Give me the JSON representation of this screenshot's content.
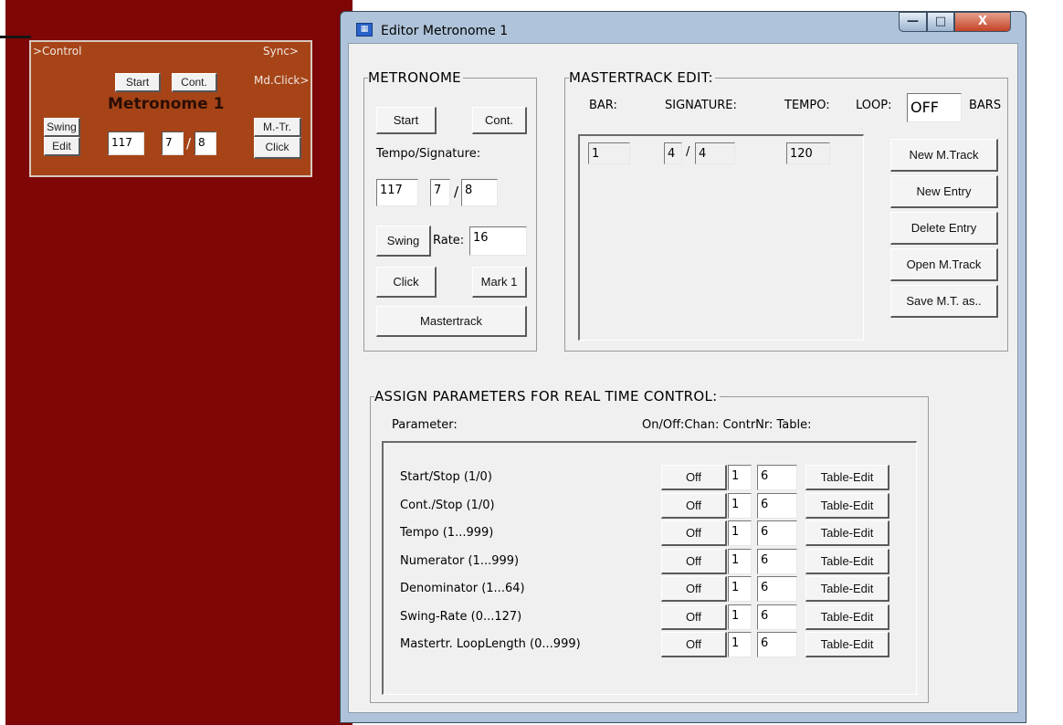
{
  "module": {
    "in_label": ">Control",
    "sync_label": "Sync>",
    "mdclick_label": "Md.Click>",
    "title": "Metronome 1",
    "start": "Start",
    "cont": "Cont.",
    "swing": "Swing",
    "edit": "Edit",
    "mtr": "M.-Tr.",
    "click": "Click",
    "tempo": "117",
    "numerator": "7",
    "slash": "/",
    "denominator": "8"
  },
  "window": {
    "title": "Editor Metronome 1",
    "icon": "app-icon",
    "minimize": "—",
    "maximize": "□",
    "close": "X"
  },
  "metronome": {
    "title": "METRONOME",
    "start": "Start",
    "cont": "Cont.",
    "tempo_sig_label": "Tempo/Signature:",
    "tempo": "117",
    "numerator": "7",
    "slash": "/",
    "denominator": "8",
    "swing": "Swing",
    "rate_label": "Rate:",
    "rate": "16",
    "click": "Click",
    "mark": "Mark 1",
    "mastertrack": "Mastertrack"
  },
  "mastertrack_edit": {
    "title": "MASTERTRACK EDIT:",
    "bar_label": "BAR:",
    "signature_label": "SIGNATURE:",
    "tempo_label": "TEMPO:",
    "loop_label": "LOOP:",
    "loop_value": "OFF",
    "bars_label": "BARS",
    "entry": {
      "bar": "1",
      "numerator": "4",
      "slash": "/",
      "denominator": "4",
      "tempo": "120"
    },
    "buttons": [
      "New M.Track",
      "New Entry",
      "Delete Entry",
      "Open M.Track",
      "Save M.T. as.."
    ]
  },
  "assign": {
    "title": "ASSIGN PARAMETERS FOR REAL TIME CONTROL:",
    "col_parameter": "Parameter:",
    "col_right": "On/Off:Chan: ContrNr:  Table:",
    "rows": [
      {
        "label": "Start/Stop (1/0)",
        "onoff": "Off",
        "chan": "1",
        "ctrl": "6",
        "table": "Table-Edit"
      },
      {
        "label": "Cont./Stop (1/0)",
        "onoff": "Off",
        "chan": "1",
        "ctrl": "6",
        "table": "Table-Edit"
      },
      {
        "label": "Tempo (1...999)",
        "onoff": "Off",
        "chan": "1",
        "ctrl": "6",
        "table": "Table-Edit"
      },
      {
        "label": "Numerator (1...999)",
        "onoff": "Off",
        "chan": "1",
        "ctrl": "6",
        "table": "Table-Edit"
      },
      {
        "label": "Denominator (1...64)",
        "onoff": "Off",
        "chan": "1",
        "ctrl": "6",
        "table": "Table-Edit"
      },
      {
        "label": "Swing-Rate (0...127)",
        "onoff": "Off",
        "chan": "1",
        "ctrl": "6",
        "table": "Table-Edit"
      },
      {
        "label": "Mastertr. LoopLength (0...999)",
        "onoff": "Off",
        "chan": "1",
        "ctrl": "6",
        "table": "Table-Edit"
      }
    ]
  },
  "colors": {
    "workspace": "#7e0606",
    "module": "#a64418",
    "window_frame": "#afc4da",
    "client": "#f0f0f0"
  }
}
